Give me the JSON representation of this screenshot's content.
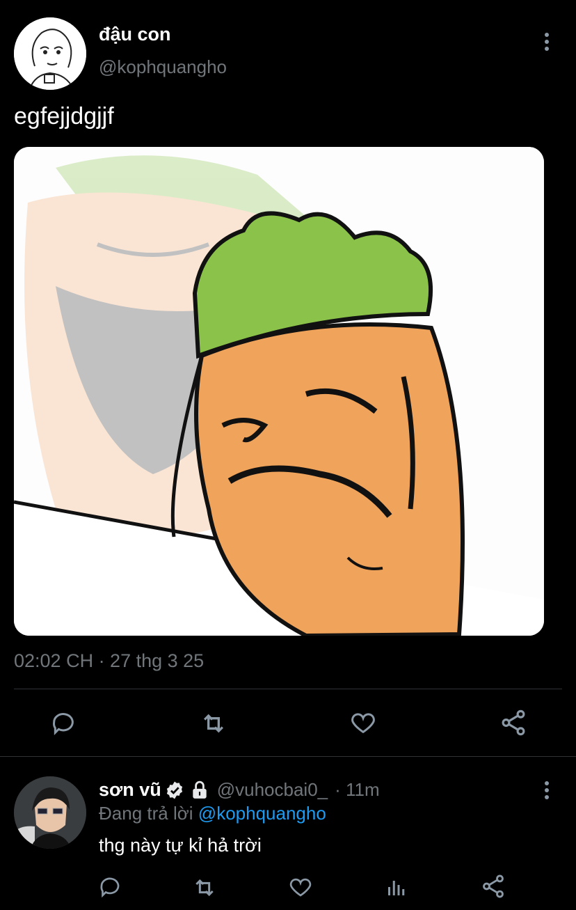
{
  "tweet": {
    "author_name": "đậu con",
    "author_handle": "@kophquangho",
    "text": "egfejjdgjjf",
    "media_icon": "carrot-character-drawing",
    "timestamp": "02:02 CH · 27 thg 3 25",
    "actions": [
      "reply-icon",
      "retweet-icon",
      "like-icon",
      "share-icon"
    ]
  },
  "reply": {
    "author_name": "sơn vũ",
    "verified_icon": "verified-badge-icon",
    "lock_icon": "lock-icon",
    "author_handle": "@vuhocbai0_",
    "time": "· 11m",
    "replying_prefix": "Đang trả lời",
    "replying_to": "@kophquangho",
    "text": "thg này tự kỉ hả trời",
    "actions": [
      "reply-icon",
      "retweet-icon",
      "like-icon",
      "analytics-icon",
      "share-icon"
    ]
  },
  "colors": {
    "background": "#000000",
    "text": "#e7e9ea",
    "muted": "#71767b",
    "link": "#1d9bf0",
    "divider": "#2f3336"
  }
}
